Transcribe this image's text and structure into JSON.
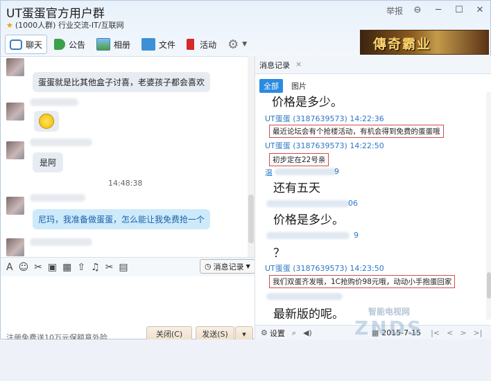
{
  "window": {
    "title": "UT蛋蛋官方用户群",
    "subtitle": "(1000人群) 行业交流-IT/互联网",
    "report": "举报",
    "controls": [
      "⊖",
      "─",
      "☐",
      "✕"
    ]
  },
  "toolbar": {
    "items": [
      "聊天",
      "公告",
      "相册",
      "文件",
      "活动"
    ]
  },
  "banner": {
    "text": "傳奇霸业"
  },
  "chat": {
    "messages": [
      "蛋蛋就是比其他盒子讨喜，老婆孩子都会喜欢",
      "是阿",
      "尼玛，我准备做蛋蛋，怎么能让我免费抢一个"
    ],
    "timestamp": "14:48:38"
  },
  "input_toolbar": {
    "icons": [
      "A",
      "☺",
      "✂",
      "▣",
      "▦",
      "⇧",
      "♫",
      "✂",
      "▤"
    ],
    "history_button": "消息记录"
  },
  "footer": {
    "promo": "注册免费送10万元保额意外险",
    "close": "关闭(C)",
    "send": "发送(S)",
    "dropdown": "▾"
  },
  "history": {
    "tab": "消息记录",
    "tab_close": "×",
    "subtabs": [
      "全部",
      "图片"
    ],
    "lines": [
      {
        "kind": "big",
        "text": "价格是多少。"
      },
      {
        "kind": "meta",
        "text": "UT蛋蛋 (3187639573) 14:22:36"
      },
      {
        "kind": "boxed",
        "text": "最近论坛会有个抢楼活动，有机会得到免费的蛋蛋哦"
      },
      {
        "kind": "meta",
        "text": "UT蛋蛋 (3187639573) 14:22:50"
      },
      {
        "kind": "boxed",
        "text": "初步定在22号亲"
      },
      {
        "kind": "partial",
        "text": "温"
      },
      {
        "kind": "partial",
        "text": "9"
      },
      {
        "kind": "big",
        "text": "还有五天"
      },
      {
        "kind": "partial",
        "text": "06"
      },
      {
        "kind": "big",
        "text": "价格是多少。"
      },
      {
        "kind": "partial",
        "text": "9"
      },
      {
        "kind": "big",
        "text": "？"
      },
      {
        "kind": "meta",
        "text": "UT蛋蛋 (3187639573) 14:23:50"
      },
      {
        "kind": "boxed",
        "text": "我们双蛋齐发哦，1C抢购价98元哦，动动小手抱蛋回家"
      },
      {
        "kind": "big",
        "text": "最新版的呢。"
      }
    ],
    "footer": {
      "settings": "设置",
      "date": "2015-7-15",
      "nav": [
        "|<",
        "<",
        ">",
        ">|"
      ]
    }
  },
  "watermark": {
    "line1": "智能电视网",
    "line2": "ZNDS"
  }
}
